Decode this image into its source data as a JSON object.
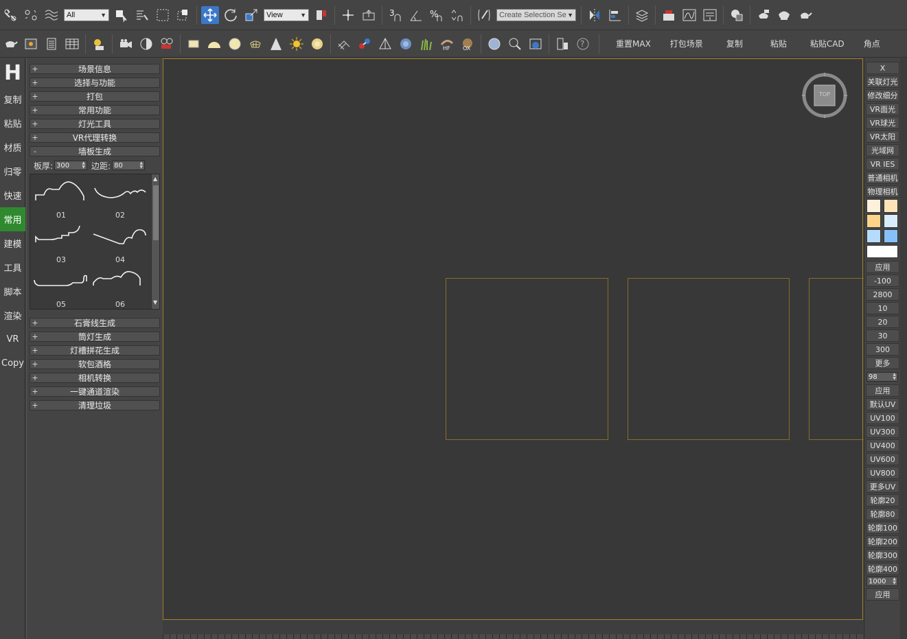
{
  "toolbar_main": {
    "selection_filter": "All",
    "coord_system": "View",
    "named_selection_placeholder": "Create Selection Se"
  },
  "toolbar_secondary": {
    "text_buttons": [
      "重置MAX",
      "打包场景",
      "复制",
      "粘贴",
      "粘贴CAD",
      "角点"
    ]
  },
  "left_tabs": {
    "logo": "H",
    "items": [
      "复制",
      "粘贴",
      "材质",
      "归零",
      "快速",
      "常用",
      "建模",
      "工具",
      "脚本",
      "渲染",
      "VR",
      "Copy"
    ],
    "active": "常用"
  },
  "rollouts_top": [
    {
      "sign": "+",
      "label": "场景信息"
    },
    {
      "sign": "+",
      "label": "选择与功能"
    },
    {
      "sign": "+",
      "label": "打包"
    },
    {
      "sign": "+",
      "label": "常用功能"
    },
    {
      "sign": "+",
      "label": "灯光工具"
    },
    {
      "sign": "+",
      "label": "VR代理转换"
    },
    {
      "sign": "-",
      "label": "墙板生成"
    }
  ],
  "wall_panel": {
    "thickness_label": "板厚:",
    "thickness_value": "300",
    "margin_label": "边距:",
    "margin_value": "80",
    "thumbnails": [
      "01",
      "02",
      "03",
      "04",
      "05",
      "06"
    ]
  },
  "rollouts_bottom": [
    {
      "sign": "+",
      "label": "石膏线生成"
    },
    {
      "sign": "+",
      "label": "筒灯生成"
    },
    {
      "sign": "+",
      "label": "灯槽拼花生成"
    },
    {
      "sign": "+",
      "label": "软包酒格"
    },
    {
      "sign": "+",
      "label": "相机转换"
    },
    {
      "sign": "+",
      "label": "一键通道渲染"
    },
    {
      "sign": "+",
      "label": "清理垃圾"
    }
  ],
  "viewport": {
    "viewcube_label": "TOP"
  },
  "right_panel": {
    "close": "X",
    "buttons_top": [
      "关联灯光",
      "修改细分",
      "VR面光",
      "VR球光",
      "VR太阳",
      "光域网",
      "VR IES",
      "普通相机",
      "物理相机"
    ],
    "swatch_colors": [
      "#fdf0dc",
      "#fde4b8",
      "#fdd38a",
      "#d8ecfc",
      "#b6dcfc",
      "#86c0f8",
      "#ffffff"
    ],
    "apply1": "应用",
    "values": [
      "-100",
      "2800",
      "10",
      "20",
      "30",
      "300"
    ],
    "more": "更多",
    "spinner1": "98",
    "apply2": "应用",
    "uv_buttons": [
      "默认UV",
      "UV100",
      "UV300",
      "UV400",
      "UV600",
      "UV800",
      "更多UV"
    ],
    "outline_buttons": [
      "轮廓20",
      "轮廓80",
      "轮廓100",
      "轮廓200",
      "轮廓300",
      "轮廓400"
    ],
    "spinner2": "1000",
    "apply3": "应用"
  }
}
